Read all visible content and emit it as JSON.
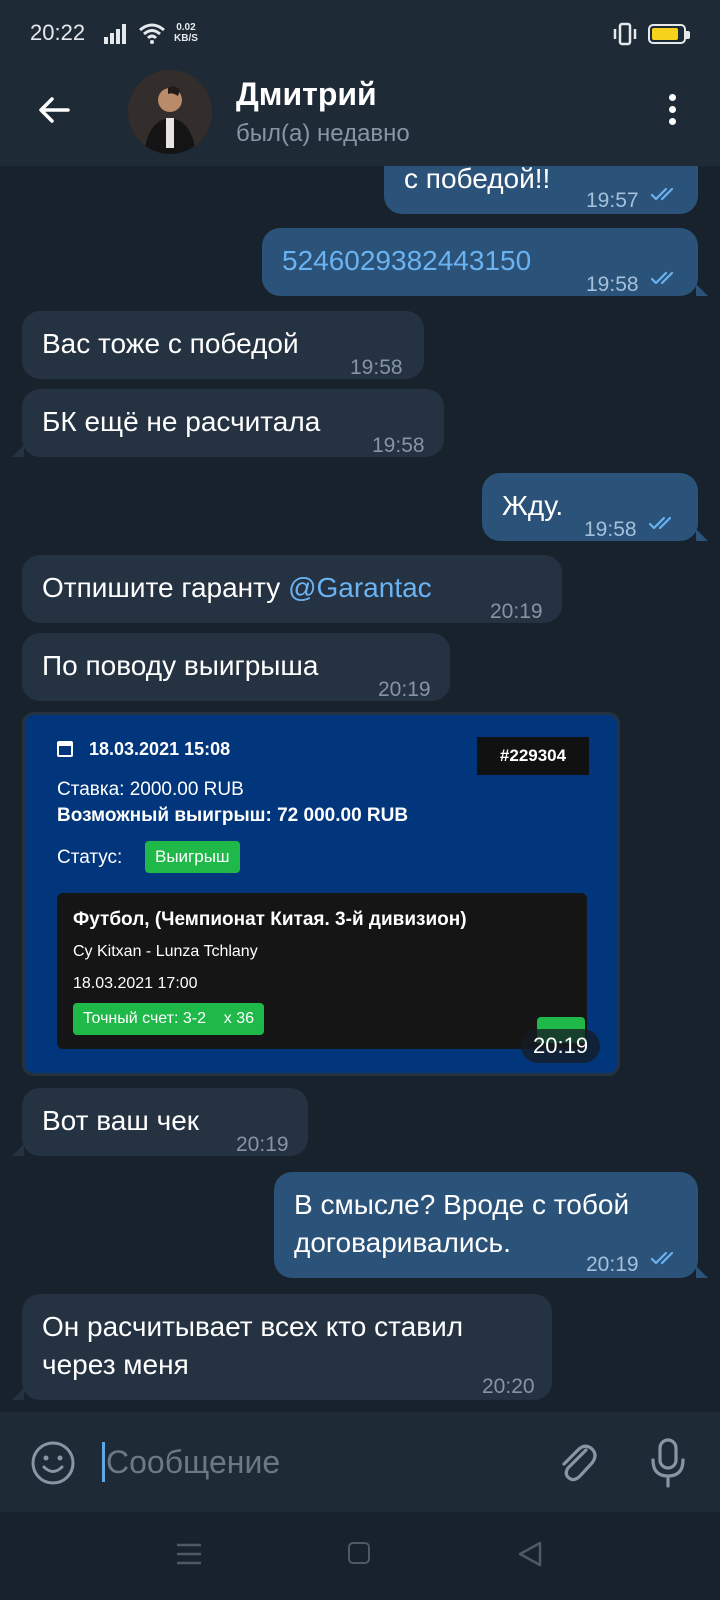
{
  "status_bar": {
    "time": "20:22",
    "speed_value": "0.02",
    "speed_unit": "KB/S"
  },
  "header": {
    "name": "Дмитрий",
    "status": "был(а) недавно"
  },
  "messages": [
    {
      "dir": "out",
      "text": "с победой!!",
      "time": "19:57",
      "read": true
    },
    {
      "dir": "out",
      "text": "5246029382443150",
      "time": "19:58",
      "read": true,
      "is_link": true
    },
    {
      "dir": "in",
      "text": "Вас тоже с победой",
      "time": "19:58"
    },
    {
      "dir": "in",
      "text": "БК ещё не расчитала",
      "time": "19:58"
    },
    {
      "dir": "out",
      "text": "Жду.",
      "time": "19:58",
      "read": true
    },
    {
      "dir": "in",
      "text": "Отпишите гаранту ",
      "mention": "@Garantac",
      "time": "20:19"
    },
    {
      "dir": "in",
      "text": "По поводу выигрыша",
      "time": "20:19"
    },
    {
      "dir": "in",
      "text": "Вот ваш чек",
      "time": "20:19"
    },
    {
      "dir": "out",
      "text_lines": [
        "В смысле? Вроде с тобой",
        "договаривались."
      ],
      "time": "20:19",
      "read": true
    },
    {
      "dir": "in",
      "text_lines": [
        "Он расчитывает всех кто ставил",
        "через меня"
      ],
      "time": "20:20"
    }
  ],
  "photo": {
    "time": "20:19",
    "date": "18.03.2021 15:08",
    "bet_id": "#229304",
    "stake": "Ставка: 2000.00 RUB",
    "possible_win": "Возможный выигрыш: 72 000.00 RUB",
    "status_label": "Статус:",
    "status_value": "Выигрыш",
    "sport": "Футбол, (Чемпионат Китая. 3-й дивизион)",
    "teams": "Cy Kitxan - Lunza Tchlany",
    "event_date": "18.03.2021 17:00",
    "exact_score": "Точный счет: 3-2    x 36"
  },
  "composer": {
    "placeholder": "Сообщение"
  },
  "colors": {
    "incoming": "#253241",
    "outgoing": "#2b5278",
    "background": "#18222d",
    "header": "#1e2a36",
    "link": "#6ab3f3",
    "ticks": "#6ab3f3"
  },
  "icons": [
    "back-arrow-icon",
    "more-vertical-icon",
    "emoji-icon",
    "paperclip-icon",
    "microphone-icon",
    "double-check-icon"
  ]
}
